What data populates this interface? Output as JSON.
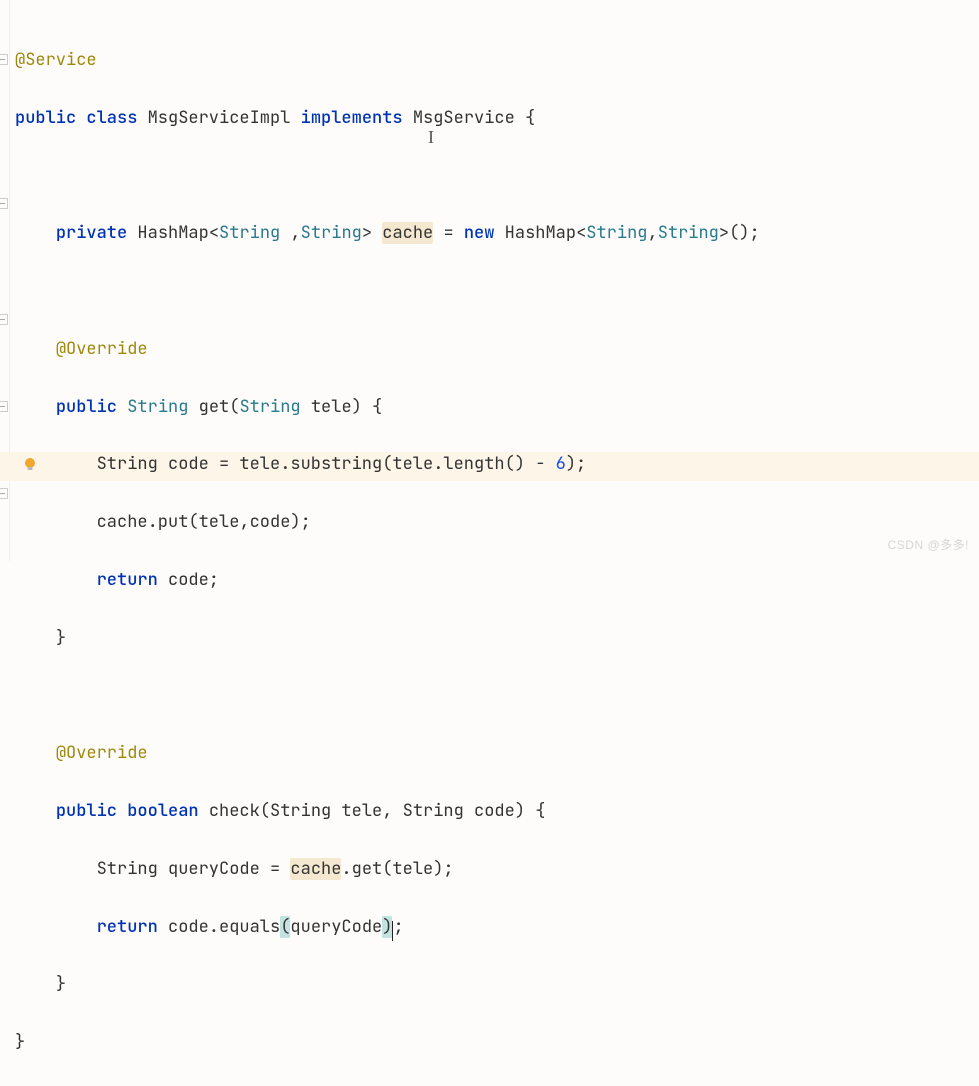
{
  "code": {
    "annotation_service": "@Service",
    "class_decl_prefix": "public class ",
    "class_name": "MsgServiceImpl",
    "implements_kw": " implements ",
    "interface_name": "MsgService",
    "open_brace": " {",
    "field_private": "private ",
    "field_type": "HashMap",
    "generic_open": "<",
    "string_type": "String",
    "generic_sep1": " ,",
    "generic_close": ">",
    "field_name": "cache",
    "field_assign": " = ",
    "new_kw": "new ",
    "ctor_type": "HashMap",
    "generic_sep2": ",",
    "ctor_call_end": "();",
    "annotation_override": "@Override",
    "get_decl_pub": "public ",
    "get_ret": "String",
    "get_name": "get",
    "get_param_open": "(",
    "get_param_type": "String",
    "get_param_name": " tele",
    "get_param_close": ") {",
    "code_var": "String code = tele.substring(tele.length() - ",
    "num_6": "6",
    "code_var_end": ");",
    "cache_put": "cache.put(tele,code);",
    "return_code": "return code;",
    "close_brace": "}",
    "check_decl_pub": "public ",
    "check_ret": "boolean",
    "check_name": "check",
    "check_params": "(String tele, String code) {",
    "query_line_prefix": "String queryCode = ",
    "cache_ref": "cache",
    "query_line_suffix": ".get(tele);",
    "return_kw": "return",
    "equals_call_prefix": " code.equals",
    "paren_open": "(",
    "query_code_var": "queryCode",
    "paren_close": ")",
    "semicolon": ";"
  },
  "watermark": "CSDN @多多!",
  "editor": {
    "bulb_tooltip": "Show Context Actions"
  }
}
